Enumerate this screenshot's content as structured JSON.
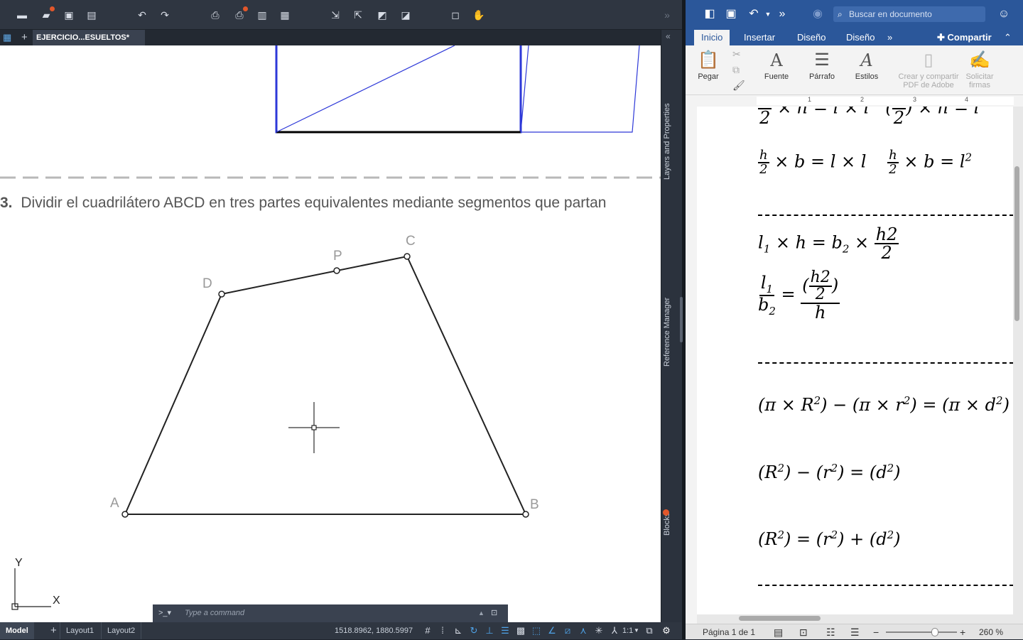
{
  "cad": {
    "doc_tab": "EJERCICIO...ESUELTOS*",
    "exercise_number": "3.",
    "exercise_text": "Dividir el cuadrilátero ABCD en tres partes equivalentes mediante segmentos que partan",
    "points": {
      "A": "A",
      "B": "B",
      "C": "C",
      "D": "D",
      "P": "P"
    },
    "axis_x": "X",
    "axis_y": "Y",
    "palette": {
      "layers": "Layers and Properties",
      "reference": "Reference Manager",
      "blocks": "Blocks"
    },
    "command_prompt": ">_▾",
    "command_placeholder": "Type a command",
    "status": {
      "model": "Model",
      "layout1": "Layout1",
      "layout2": "Layout2",
      "coords": "1518.8962, 1880.5997",
      "scale": "1:1"
    },
    "accent": "#4fa3e8"
  },
  "word": {
    "search_placeholder": "Buscar en documento",
    "tabs": [
      "Inicio",
      "Insertar",
      "Diseño",
      "Diseño"
    ],
    "share": "Compartir",
    "ribbon": {
      "paste": "Pegar",
      "font": "Fuente",
      "paragraph": "Párrafo",
      "styles": "Estilos",
      "pdf": "Crear y compartir PDF de Adobe",
      "sign": "Solicitar firmas"
    },
    "ruler_marks": [
      "1",
      "2",
      "3",
      "4"
    ],
    "status": {
      "page": "Página 1 de 1",
      "zoom": "260 %"
    },
    "brand": "#2b579a"
  }
}
